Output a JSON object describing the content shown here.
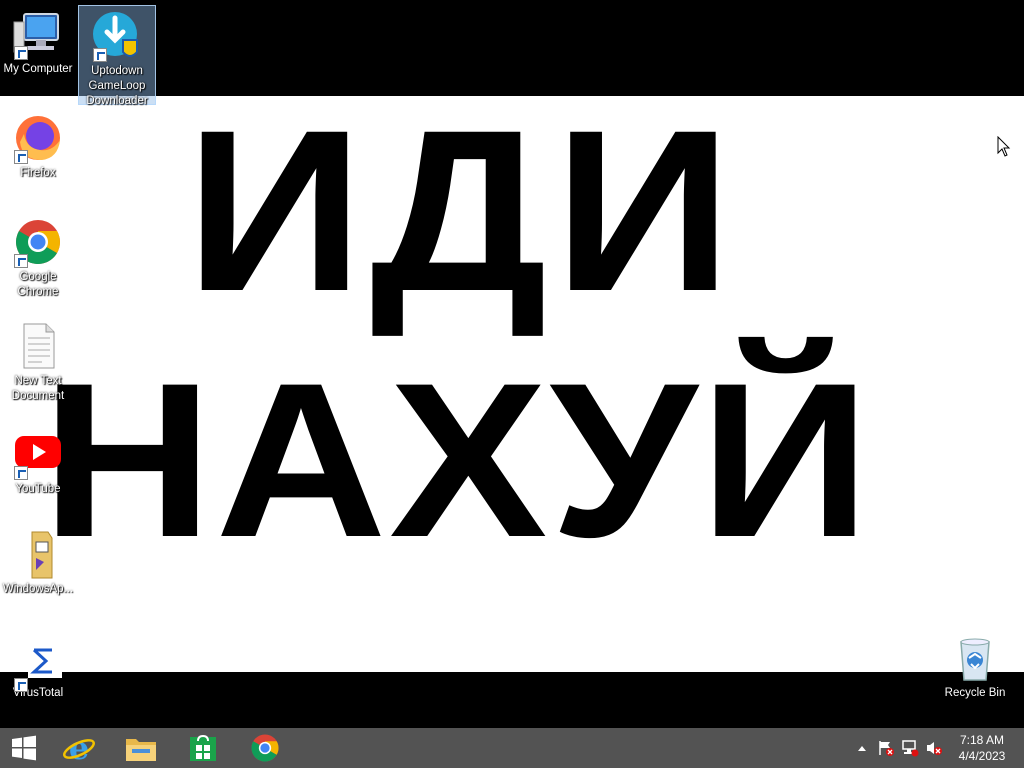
{
  "wallpaper": {
    "line1": "ИДИ",
    "line2": "НАХУЙ"
  },
  "desktop_icons": [
    {
      "label": "My Computer",
      "icon": "computer-icon"
    },
    {
      "label": "Uptodown GameLoop Downloader",
      "icon": "uptodown-icon",
      "selected": true
    },
    {
      "label": "Firefox",
      "icon": "firefox-icon"
    },
    {
      "label": "Google Chrome",
      "icon": "chrome-icon"
    },
    {
      "label": "New Text Document",
      "icon": "text-document-icon"
    },
    {
      "label": "YouTube",
      "icon": "youtube-icon"
    },
    {
      "label": "WindowsAp...",
      "icon": "folder-icon"
    },
    {
      "label": "VirusTotal",
      "icon": "virustotal-icon"
    },
    {
      "label": "Recycle Bin",
      "icon": "recycle-bin-icon"
    }
  ],
  "taskbar": {
    "items": [
      "start-icon",
      "internet-explorer-icon",
      "file-explorer-icon",
      "store-icon",
      "chrome-icon"
    ]
  },
  "tray": {
    "time": "7:18 AM",
    "date": "4/4/2023",
    "icons": [
      "show-hidden-icons-chevron",
      "action-center-flag-icon",
      "network-icon",
      "volume-muted-icon"
    ]
  },
  "colors": {
    "taskbar": "#535353",
    "desktop_background": "#000000",
    "wallpaper": "#ffffff",
    "selection": "#8cb9e6"
  }
}
